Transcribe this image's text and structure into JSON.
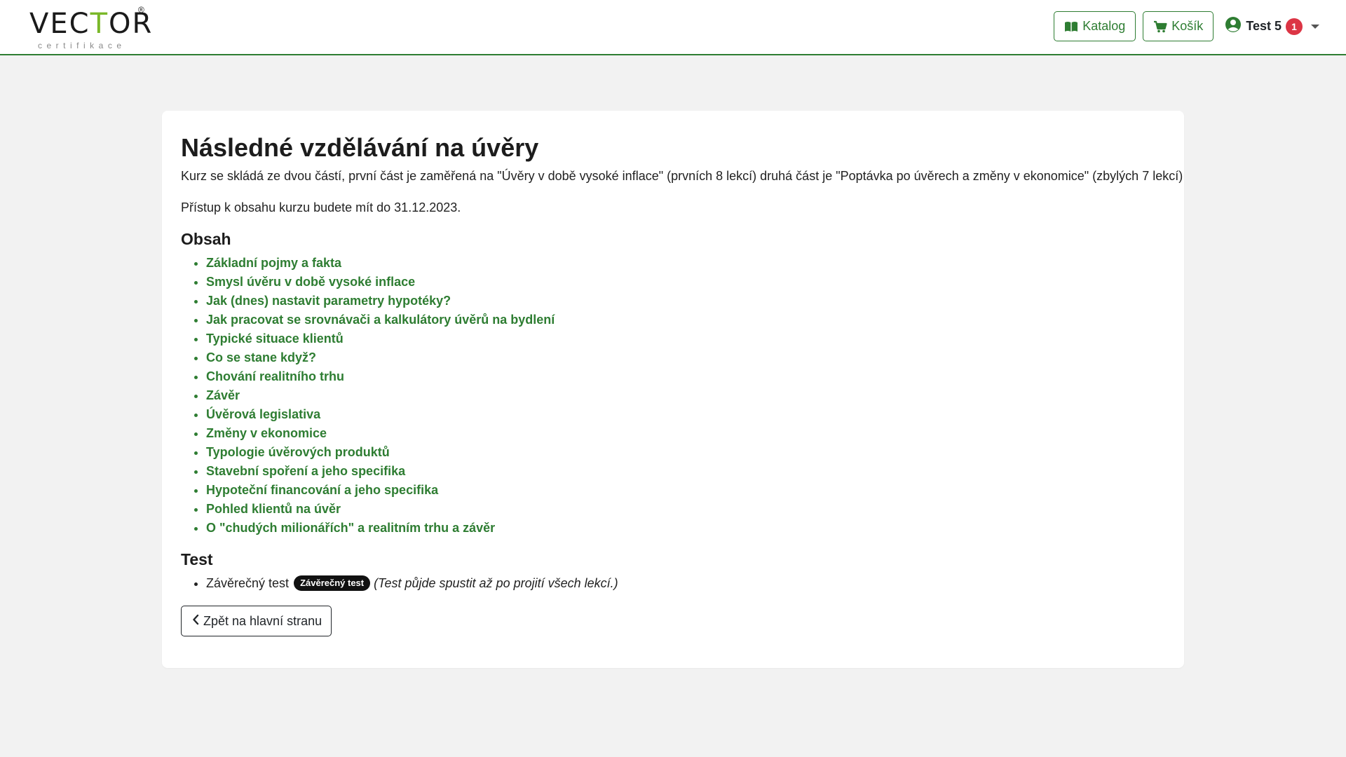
{
  "header": {
    "logo_text_left": "VEC",
    "logo_text_accent": "T",
    "logo_text_mid": "O",
    "logo_text_right": "R",
    "logo_reg": "®",
    "logo_sub": "certifikace",
    "catalog_label": "Katalog",
    "cart_label": "Košík",
    "user_name": "Test 5",
    "notifications_count": "1",
    "icons": {
      "catalog": "book-open-icon",
      "cart": "cart-icon",
      "user": "user-circle-icon",
      "caret": "caret-down-icon"
    }
  },
  "course": {
    "title": "Následné vzdělávání na úvěry",
    "description": "Kurz se skládá ze dvou částí, první část je zaměřená na \"Úvěry v době vysoké inflace\" (prvních 8 lekcí) druhá část je \"Poptávka po úvěrech a změny v ekonomice\" (zbylých 7 lekcí)",
    "access": "Přístup k obsahu kurzu budete mít do 31.12.2023.",
    "contents_heading": "Obsah",
    "lessons": [
      "Základní pojmy a fakta",
      "Smysl úvěru v době vysoké inflace",
      "Jak (dnes) nastavit parametry hypotéky?",
      "Jak pracovat se srovnávači a kalkulátory úvěrů na bydlení",
      "Typické situace klientů",
      "Co se stane když?",
      "Chování realitního trhu",
      "Závěr",
      "Úvěrová legislativa",
      "Změny v ekonomice",
      "Typologie úvěrových produktů",
      "Stavební spoření a jeho specifika",
      "Hypoteční financování a jeho specifika",
      "Pohled klientů na úvěr",
      "O \"chudých milionářích\" a realitním trhu a závěr"
    ],
    "test_heading": "Test",
    "test_item_label": "Závěrečný test",
    "test_badge": "Závěrečný test",
    "test_note": "(Test půjde spustit až po projití všech lekcí.)",
    "back_label": "Zpět na hlavní stranu"
  },
  "colors": {
    "brand_green": "#2e7d32",
    "logo_accent": "#7ab829",
    "badge_red": "#dc3545",
    "background": "#f2f2f2"
  }
}
